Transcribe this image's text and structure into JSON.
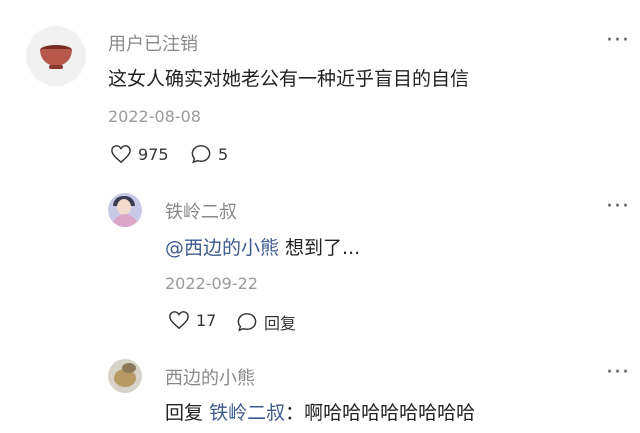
{
  "comments": [
    {
      "username": "用户已注销",
      "text": "这女人确实对她老公有一种近乎盲目的自信",
      "date": "2022-08-08",
      "likes": "975",
      "replies": "5"
    },
    {
      "username": "铁岭二叔",
      "mention": "@西边的小熊",
      "text": " 想到了...",
      "date": "2022-09-22",
      "likes": "17",
      "reply_label": "回复"
    },
    {
      "username": "西边的小熊",
      "reply_prefix": "回复",
      "reply_to": "铁岭二叔",
      "separator": "：",
      "text": "啊哈哈哈哈哈哈哈哈"
    }
  ],
  "more_menu": "···"
}
